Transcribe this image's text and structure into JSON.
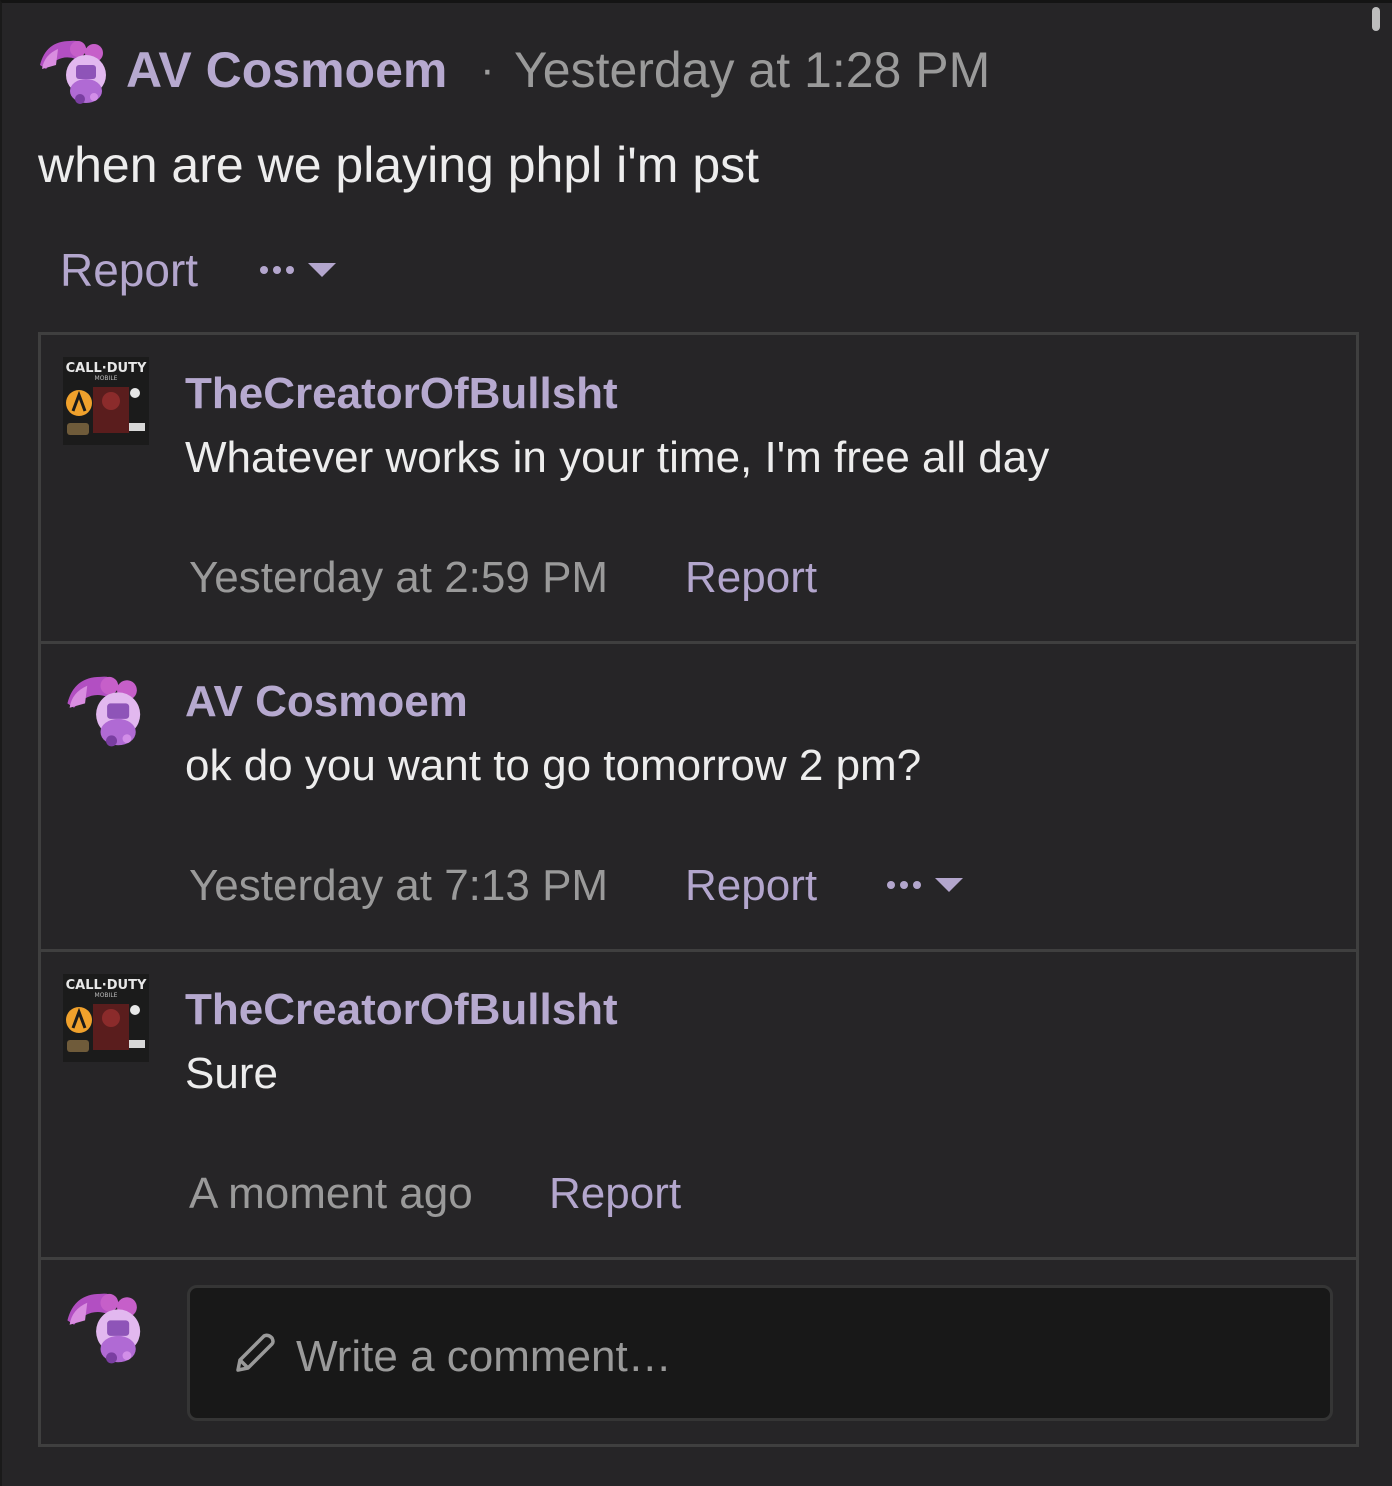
{
  "post": {
    "author": "AV Cosmoem",
    "separator": "·",
    "time": "Yesterday at 1:28 PM",
    "body": "when are we playing phpl i'm pst",
    "report_label": "Report"
  },
  "comments": [
    {
      "author": "TheCreatorOfBullsht",
      "body": "Whatever works in your time, I'm free all day",
      "time": "Yesterday at 2:59 PM",
      "report_label": "Report",
      "avatar": "call-of-duty-mobile-avatar"
    },
    {
      "author": "AV Cosmoem",
      "body": "ok do you want to go tomorrow 2 pm?",
      "time": "Yesterday at 7:13 PM",
      "report_label": "Report",
      "avatar": "anime-character-avatar"
    },
    {
      "author": "TheCreatorOfBullsht",
      "body": "Sure",
      "time": "A moment ago",
      "report_label": "Report",
      "avatar": "call-of-duty-mobile-avatar"
    }
  ],
  "composer": {
    "placeholder": "Write a comment…"
  },
  "avatar_text": {
    "cod_logo": "CALL·DUTY",
    "cod_sub": "MOBILE"
  },
  "colors": {
    "background": "#262527",
    "accent_purple": "#b3a6cd",
    "text_primary": "#ededed",
    "text_muted": "#9a9a9a",
    "border": "#3f3f3f",
    "composer_bg": "#181818"
  }
}
